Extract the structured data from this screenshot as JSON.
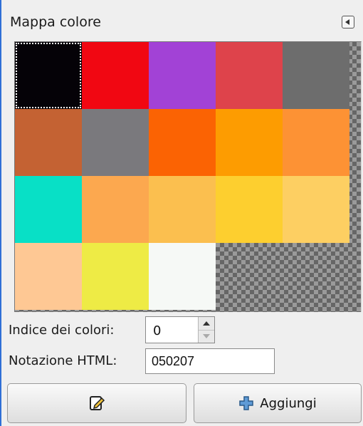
{
  "header": {
    "title": "Mappa colore",
    "menu_icon": "tab-menu-icon"
  },
  "colormap": {
    "selected_index": 0,
    "colors": [
      "#050207",
      "#f10712",
      "#a242d6",
      "#de434b",
      "#6d6d6d",
      "#c46233",
      "#7a797d",
      "#fb6303",
      "#fd9c01",
      "#fd9234",
      "#08e0c6",
      "#fca84f",
      "#fbbf4f",
      "#fdcf2f",
      "#fdcf62",
      "#fec894",
      "#eeeb45",
      "#f6f9f6"
    ]
  },
  "fields": {
    "index_label": "Indice dei colori:",
    "index_value": "0",
    "html_label": "Notazione HTML:",
    "html_value": "050207"
  },
  "buttons": {
    "edit_icon": "edit-color-icon",
    "add_icon": "add-icon",
    "add_label": "Aggiungi"
  }
}
